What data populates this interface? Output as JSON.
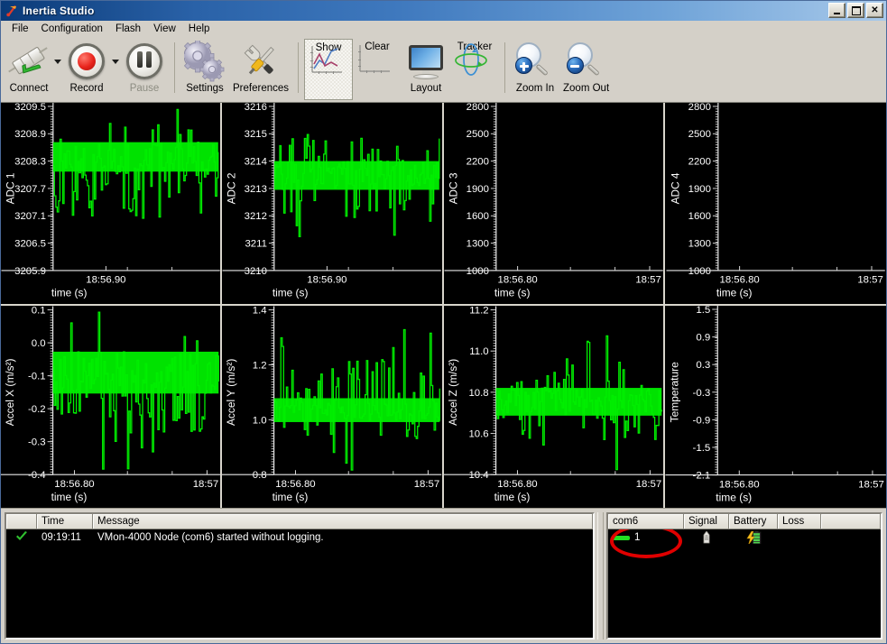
{
  "window": {
    "title": "Inertia Studio",
    "icon": "app-logo-icon",
    "controls": {
      "minimize": "_",
      "maximize": "□",
      "close": "✕"
    }
  },
  "menu": {
    "items": [
      "File",
      "Configuration",
      "Flash",
      "View",
      "Help"
    ]
  },
  "toolbar": {
    "groups": [
      {
        "items": [
          {
            "label": "Connect",
            "icon": "connect-plug-check-icon",
            "dropdown": true,
            "enabled": true,
            "active": false
          },
          {
            "label": "Record",
            "icon": "record-circle-icon",
            "dropdown": true,
            "enabled": true,
            "active": false
          },
          {
            "label": "Pause",
            "icon": "pause-circle-icon",
            "dropdown": false,
            "enabled": false,
            "active": false
          }
        ]
      },
      {
        "items": [
          {
            "label": "Settings",
            "icon": "gears-icon",
            "dropdown": false,
            "enabled": true,
            "active": false
          },
          {
            "label": "Preferences",
            "icon": "wrench-screwdriver-icon",
            "dropdown": false,
            "enabled": true,
            "active": false
          }
        ]
      },
      {
        "items": [
          {
            "label": "Show",
            "icon": "line-chart-icon",
            "dropdown": false,
            "enabled": true,
            "active": true
          },
          {
            "label": "Clear",
            "icon": "empty-axes-icon",
            "dropdown": false,
            "enabled": true,
            "active": false
          },
          {
            "label": "Layout",
            "icon": "monitor-icon",
            "dropdown": false,
            "enabled": true,
            "active": false
          },
          {
            "label": "Tracker",
            "icon": "orbit-rotate-icon",
            "dropdown": false,
            "enabled": true,
            "active": false
          }
        ]
      },
      {
        "items": [
          {
            "label": "Zoom In",
            "icon": "magnifier-plus-icon",
            "dropdown": false,
            "enabled": true,
            "active": false
          },
          {
            "label": "Zoom Out",
            "icon": "magnifier-minus-icon",
            "dropdown": false,
            "enabled": true,
            "active": false
          }
        ]
      }
    ]
  },
  "chart_data": [
    {
      "type": "line",
      "title": "ADC 1",
      "ylabel": "ADC 1",
      "xlabel": "time (s)",
      "ylim": [
        3205.9,
        3209.8
      ],
      "yticks": [
        "3209.5",
        "3208.9",
        "3208.3",
        "3207.7",
        "3207.1",
        "3206.5",
        "3205.9"
      ],
      "xticks": [
        "18:56.90"
      ],
      "xtick_positions": [
        0.32
      ],
      "has_data": true,
      "trace_color": "#00ee00",
      "background": "#000000",
      "noise_band": [
        3207.0,
        3209.8
      ],
      "dense_band": [
        3207.1,
        3208.9
      ],
      "core_band": [
        3208.25,
        3208.95
      ],
      "seed": 11
    },
    {
      "type": "line",
      "title": "ADC 2",
      "ylabel": "ADC 2",
      "xlabel": "time (s)",
      "ylim": [
        3210,
        3216
      ],
      "yticks": [
        "3216",
        "3215",
        "3214",
        "3213",
        "3212",
        "3211",
        "3210"
      ],
      "xticks": [
        "18:56.90"
      ],
      "xtick_positions": [
        0.32
      ],
      "has_data": true,
      "trace_color": "#00ee00",
      "background": "#000000",
      "noise_band": [
        3211.0,
        3215.1
      ],
      "dense_band": [
        3211.9,
        3215.0
      ],
      "core_band": [
        3212.95,
        3214.0
      ],
      "seed": 27
    },
    {
      "type": "line",
      "title": "ADC 3",
      "ylabel": "ADC 3",
      "xlabel": "time (s)",
      "ylim": [
        1000,
        2900
      ],
      "yticks": [
        "2800",
        "2500",
        "2200",
        "1900",
        "1600",
        "1300",
        "1000"
      ],
      "xticks": [
        "18:56.80",
        "18:57"
      ],
      "xtick_positions": [
        0.13,
        0.93
      ],
      "has_data": false,
      "trace_color": "#00ee00",
      "background": "#000000"
    },
    {
      "type": "line",
      "title": "ADC 4",
      "ylabel": "ADC 4",
      "xlabel": "time (s)",
      "ylim": [
        1000,
        2900
      ],
      "yticks": [
        "2800",
        "2500",
        "2200",
        "1900",
        "1600",
        "1300",
        "1000"
      ],
      "xticks": [
        "18:56.80",
        "18:57"
      ],
      "xtick_positions": [
        0.13,
        0.93
      ],
      "has_data": false,
      "trace_color": "#00ee00",
      "background": "#000000"
    },
    {
      "type": "line",
      "title": "Accel X (m/s²)",
      "ylabel": "Accel X (m/s²)",
      "xlabel": "time (s)",
      "ylim": [
        -0.47,
        0.16
      ],
      "yticks": [
        "0.1",
        "0.0",
        "-0.1",
        "-0.2",
        "-0.3",
        "-0.4"
      ],
      "xticks": [
        "18:56.80",
        "18:57"
      ],
      "xtick_positions": [
        0.13,
        0.93
      ],
      "has_data": true,
      "trace_color": "#00ee00",
      "background": "#000000",
      "noise_band": [
        -0.47,
        0.155
      ],
      "dense_band": [
        -0.315,
        0.0
      ],
      "core_band": [
        -0.16,
        0.0
      ],
      "seed": 41
    },
    {
      "type": "line",
      "title": "Accel Y (m/s²)",
      "ylabel": "Accel Y (m/s²)",
      "xlabel": "time (s)",
      "ylim": [
        0.78,
        1.47
      ],
      "yticks": [
        "1.4",
        "1.2",
        "1.0",
        "0.8"
      ],
      "xticks": [
        "18:56.80",
        "18:57"
      ],
      "xtick_positions": [
        0.13,
        0.93
      ],
      "has_data": true,
      "trace_color": "#00ee00",
      "background": "#000000",
      "noise_band": [
        0.78,
        1.42
      ],
      "dense_band": [
        0.94,
        1.26
      ],
      "core_band": [
        1.0,
        1.1
      ],
      "seed": 59
    },
    {
      "type": "line",
      "title": "Accel Z (m/s²)",
      "ylabel": "Accel Z (m/s²)",
      "xlabel": "time (s)",
      "ylim": [
        10.33,
        11.28
      ],
      "yticks": [
        "11.2",
        "11.0",
        "10.8",
        "10.6",
        "10.4"
      ],
      "xticks": [
        "18:56.80",
        "18:57"
      ],
      "xtick_positions": [
        0.13,
        0.93
      ],
      "has_data": true,
      "trace_color": "#00ee00",
      "background": "#000000",
      "noise_band": [
        10.34,
        11.15
      ],
      "dense_band": [
        10.51,
        10.99
      ],
      "core_band": [
        10.67,
        10.83
      ],
      "seed": 73
    },
    {
      "type": "line",
      "title": "Temperature",
      "ylabel": "Temperature",
      "xlabel": "time (s)",
      "ylim": [
        -2.1,
        1.9
      ],
      "yticks": [
        "1.5",
        "0.9",
        "0.3",
        "-0.3",
        "-0.9",
        "-1.5",
        "-2.1"
      ],
      "xticks": [
        "18:56.80",
        "18:57"
      ],
      "xtick_positions": [
        0.13,
        0.93
      ],
      "has_data": false,
      "trace_color": "#00ee00",
      "background": "#000000"
    }
  ],
  "log_panel": {
    "columns": [
      "",
      "Time",
      "Message"
    ],
    "rows": [
      {
        "status_icon": "check-icon",
        "time": "09:19:11",
        "message": "VMon-4000 Node (com6) started without logging."
      }
    ]
  },
  "node_panel": {
    "columns": [
      "com6",
      "Signal",
      "Battery",
      "Loss",
      ""
    ],
    "rows": [
      {
        "node": "1",
        "node_marker": "green-dash-icon",
        "signal": "signal-icon",
        "battery": "battery-charging-icon",
        "loss": ""
      }
    ],
    "annotation": {
      "shape": "ellipse",
      "color": "#e00000"
    }
  },
  "colors": {
    "trace": "#00ee00",
    "plot_bg": "#000000",
    "chrome": "#d4d0c8",
    "title_bar_start": "#0a3a78",
    "title_bar_end": "#a8c9ea",
    "annotation": "#e00000"
  }
}
